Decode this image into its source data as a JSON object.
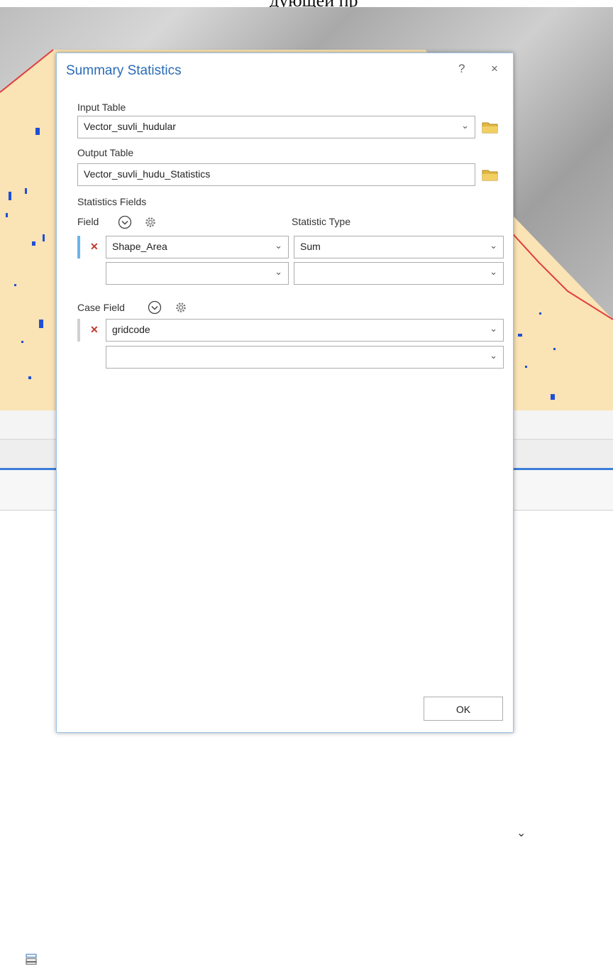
{
  "background": {
    "doc_text": "дующей пр"
  },
  "dialog": {
    "title": "Summary Statistics",
    "help_symbol": "?",
    "close_symbol": "×",
    "input_table": {
      "label": "Input Table",
      "value": "Vector_suvli_hudular"
    },
    "output_table": {
      "label": "Output Table",
      "value": "Vector_suvli_hudu_Statistics"
    },
    "statistics_fields": {
      "label": "Statistics Fields",
      "field_header": "Field",
      "type_header": "Statistic Type",
      "rows": [
        {
          "field": "Shape_Area",
          "type": "Sum"
        },
        {
          "field": "",
          "type": ""
        }
      ]
    },
    "case_field": {
      "label": "Case Field",
      "rows": [
        {
          "field": "gridcode"
        },
        {
          "field": ""
        }
      ]
    },
    "ok_label": "OK"
  },
  "colors": {
    "title_blue": "#2a6bb5",
    "accent_blue": "#3c7dd9",
    "row_marker_blue": "#6cb4e8",
    "delete_red": "#c0392b",
    "map_sand": "#fae3b4",
    "map_boundary": "#e03c3c"
  },
  "icons": [
    "folder-icon",
    "chevron-down-icon",
    "gear-icon",
    "help-icon",
    "close-icon",
    "remove-icon"
  ]
}
